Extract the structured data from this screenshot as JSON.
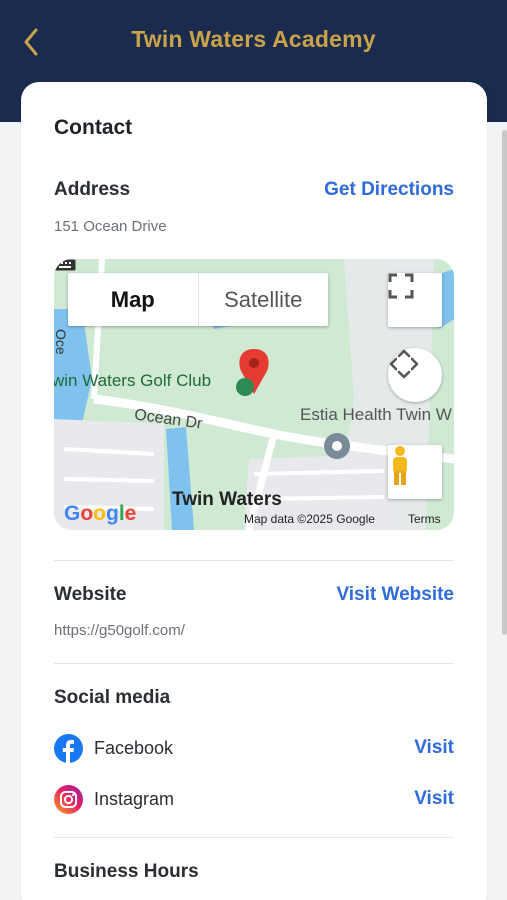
{
  "header": {
    "title": "Twin Waters Academy"
  },
  "contact": {
    "heading": "Contact",
    "address_label": "Address",
    "directions_label": "Get Directions",
    "address": "151 Ocean Drive",
    "website_label": "Website",
    "visit_website_label": "Visit Website",
    "website_url": "https://g50golf.com/",
    "social_heading": "Social media",
    "social": [
      {
        "name": "Facebook",
        "action": "Visit",
        "icon": "facebook-icon"
      },
      {
        "name": "Instagram",
        "action": "Visit",
        "icon": "instagram-icon"
      }
    ],
    "hours_heading": "Business Hours"
  },
  "map": {
    "toggle": [
      "Map",
      "Satellite"
    ],
    "selected": "Map",
    "labels": {
      "golf": "win Waters Golf Club",
      "ocean": "Ocean Dr",
      "estia": "Estia Health Twin W",
      "twin_waters": "Twin Waters",
      "oce": "Oce",
      "google": "Google",
      "attribution": "Map data ©2025 Google",
      "terms": "Terms"
    },
    "colors": {
      "park": "#cfe9d3",
      "water": "#7fc2ee",
      "road": "#ffffff",
      "pin": "#e53b30"
    }
  }
}
